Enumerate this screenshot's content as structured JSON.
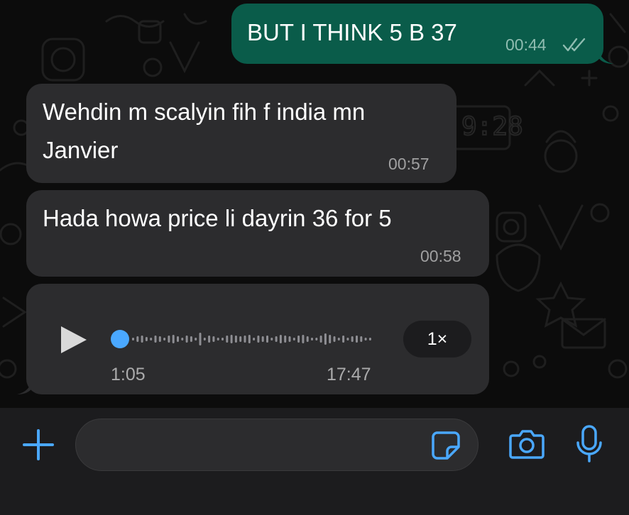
{
  "messages": [
    {
      "direction": "outgoing",
      "text": "BUT I THINK 5 B 37",
      "time": "00:44",
      "status_icon": "double-check-icon"
    },
    {
      "direction": "incoming",
      "text_lines": [
        "Wehdin m scalyin fih f india mn",
        "Janvier"
      ],
      "time": "00:57"
    },
    {
      "direction": "incoming",
      "text": "Hada howa price li dayrin 36 for 5",
      "time": "00:58"
    },
    {
      "direction": "incoming",
      "type": "voice",
      "progress": "1:05",
      "duration": "17:47",
      "speed": "1×",
      "icons": [
        "play-icon"
      ]
    }
  ],
  "composer": {
    "icons": [
      "plus-icon",
      "sticker-icon",
      "camera-icon",
      "microphone-icon"
    ]
  },
  "colors": {
    "outgoing_bubble": "#0a5c4a",
    "incoming_bubble": "#2c2c2e",
    "accent": "#4aa8ff",
    "background": "#0b0b0b"
  }
}
